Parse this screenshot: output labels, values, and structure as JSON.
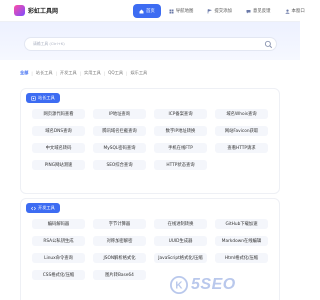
{
  "header": {
    "logo_text": "彩虹工具网",
    "nav": [
      {
        "label": "首页",
        "icon": "home-icon",
        "active": true
      },
      {
        "label": "导航地图",
        "icon": "grid-icon",
        "active": false
      },
      {
        "label": "提交添加",
        "icon": "flag-icon",
        "active": false
      },
      {
        "label": "意见反馈",
        "icon": "chat-icon",
        "active": false
      },
      {
        "label": "本窗口",
        "icon": "user-icon",
        "active": false
      }
    ]
  },
  "search": {
    "placeholder": "请输工具 (Ctrl+K)"
  },
  "categories": [
    "全部",
    "站长工具",
    "开发工具",
    "实用工具",
    "QQ工具",
    "娱乐工具"
  ],
  "sections": [
    {
      "title": "站长工具",
      "icon": "station-icon",
      "tools": [
        "网页源代码查看",
        "IP地址查询",
        "ICP备案查询",
        "域名Whois查询",
        "域名DNS查询",
        "腾讯域名拦截查询",
        "数字IP地址转换",
        "网站Favicon获取",
        "中文域名转码",
        "MySQL密码查询",
        "手机在线FTP",
        "查看HTTP请求",
        "PING网站测速",
        "SEO综合查询",
        "HTTP状态查询"
      ]
    },
    {
      "title": "开发工具",
      "icon": "code-icon",
      "tools": [
        "编码解码器",
        "字节计算器",
        "在线进制转换",
        "GitHub下载加速",
        "RSA公私钥生成",
        "对称加密解密",
        "UUID生成器",
        "Markdown在线编辑",
        "Linux命令查询",
        "JSON解析格式化",
        "JavaScript格式化/压缩",
        "Html格式化/压缩",
        "CSS格式化/压缩",
        "图片转Base64",
        "",
        ""
      ]
    }
  ],
  "watermark": {
    "prefix": "K",
    "text": "5SEO"
  },
  "colors": {
    "accent": "#3d6cf2",
    "tool_bg": "#f4f6fb",
    "hero_bg": "#edf1ff"
  }
}
